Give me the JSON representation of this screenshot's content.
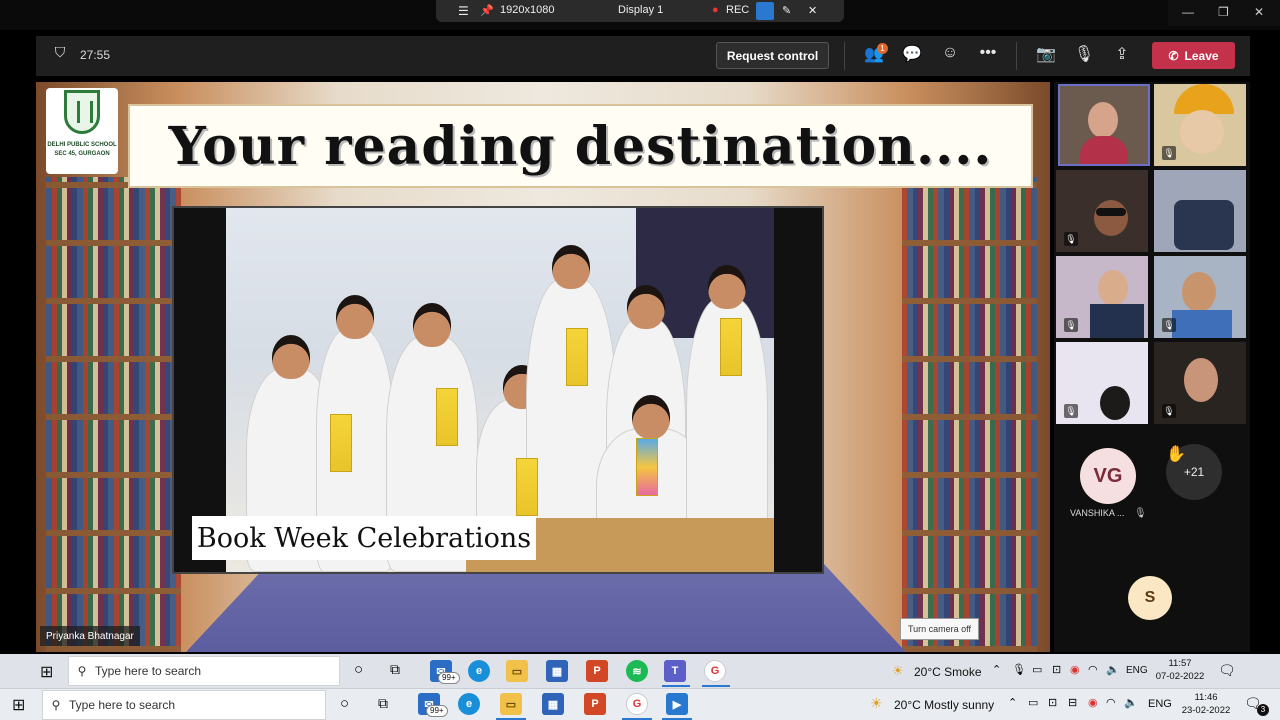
{
  "display_bar": {
    "resolution": "1920x1080",
    "display": "Display 1",
    "rec": "REC"
  },
  "meeting": {
    "timer": "27:55",
    "request_control": "Request control",
    "people_badge": "1",
    "leave": "Leave"
  },
  "slide": {
    "headline": "Your reading destination....",
    "caption": "Book Week Celebrations",
    "school_line1": "DELHI PUBLIC SCHOOL",
    "school_line2": "SEC 45, GURGAON",
    "turn_camera_off": "Turn camera off"
  },
  "presenter_name": "Priyanka Bhatnagar",
  "participants": {
    "vg_initials": "VG",
    "vg_name": "VANSHIKA ...",
    "more_count": "+21",
    "s_initials": "S"
  },
  "taskbar_inner": {
    "search_placeholder": "Type here to search",
    "mail_badge": "99+",
    "weather": "20°C  Smoke",
    "lang": "ENG",
    "time": "11:57",
    "date": "07-02-2022"
  },
  "taskbar_outer": {
    "search_placeholder": "Type here to search",
    "mail_badge": "99+",
    "weather": "20°C  Mostly sunny",
    "lang": "ENG",
    "time": "11:46",
    "date": "23-02-2022",
    "notif_count": "3"
  },
  "colors": {
    "leave": "#c4314b",
    "teams_bar": "#1f1f1f",
    "accent": "#2b78d0"
  }
}
